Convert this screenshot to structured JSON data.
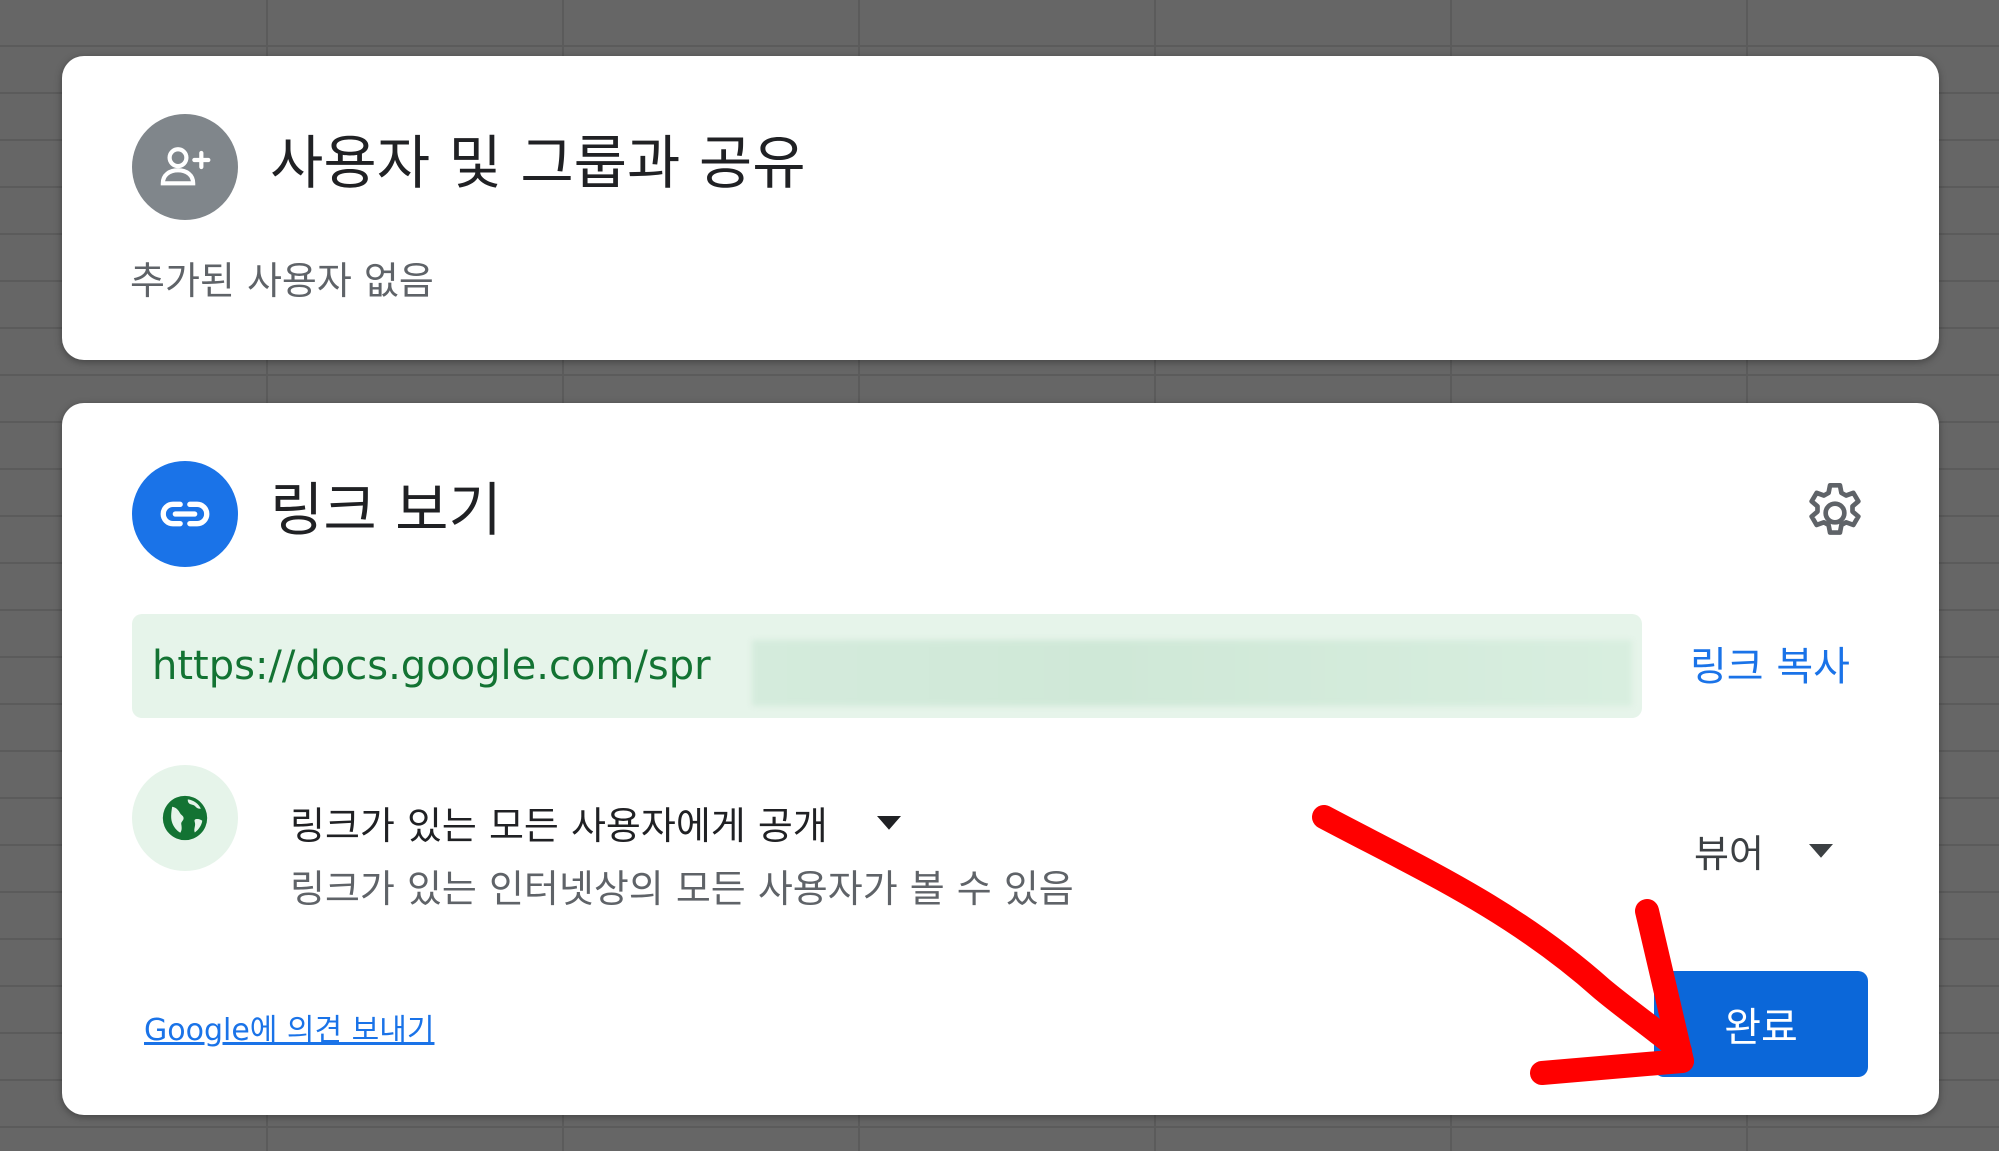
{
  "share_card": {
    "title": "사용자 및 그룹과 공유",
    "subtitle": "추가된 사용자 없음",
    "icon": "person-add-icon",
    "icon_bg": "#80868b"
  },
  "link_card": {
    "title": "링크 보기",
    "icon": "link-icon",
    "icon_bg": "#1a73e8",
    "settings_icon": "gear-icon",
    "url": "https://docs.google.com/spr",
    "copy_label": "링크 복사",
    "access": {
      "icon": "globe-icon",
      "title": "링크가 있는 모든 사용자에게 공개",
      "description": "링크가 있는 인터넷상의 모든 사용자가 볼 수 있음",
      "role": "뷰어"
    },
    "feedback_label": "Google에 의견 보내기",
    "done_label": "완료"
  },
  "annotation": {
    "type": "red-arrow",
    "color": "#ff0000"
  }
}
